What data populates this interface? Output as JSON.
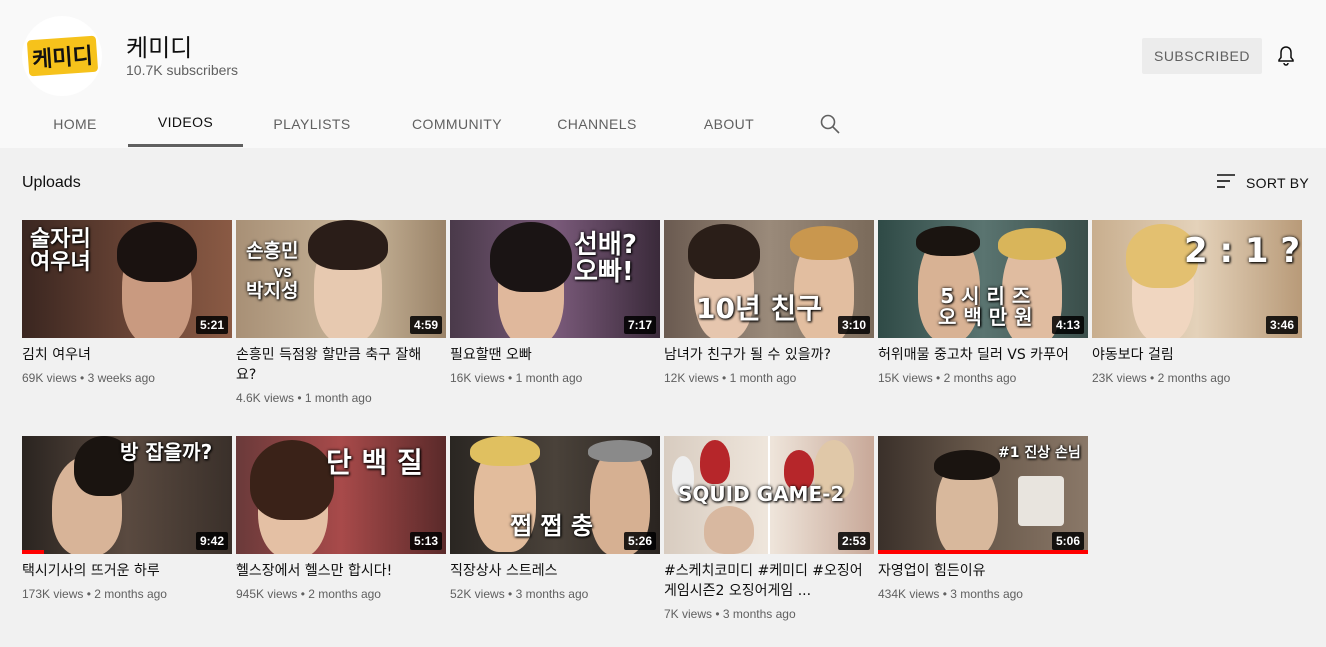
{
  "channel": {
    "name": "케미디",
    "subscribers": "10.7K subscribers",
    "avatar_text": "케미디",
    "subscribe_label": "SUBSCRIBED"
  },
  "tabs": [
    {
      "label": "HOME"
    },
    {
      "label": "VIDEOS"
    },
    {
      "label": "PLAYLISTS"
    },
    {
      "label": "COMMUNITY"
    },
    {
      "label": "CHANNELS"
    },
    {
      "label": "ABOUT"
    }
  ],
  "section": {
    "title": "Uploads",
    "sort_label": "SORT BY"
  },
  "videos": [
    {
      "title": "김치 여우녀",
      "views": "69K views",
      "age": "3 weeks ago",
      "duration": "5:21",
      "thumb_text": "술자리\n여우녀",
      "bg": "#5a3a2c"
    },
    {
      "title": "손흥민 득점왕 할만큼 축구 잘해요?",
      "views": "4.6K views",
      "age": "1 month ago",
      "duration": "4:59",
      "thumb_text": "손흥민\nVS\n박지성",
      "bg": "#b9a58c"
    },
    {
      "title": "필요할땐 오빠",
      "views": "16K views",
      "age": "1 month ago",
      "duration": "7:17",
      "thumb_text": "선배?\n오빠!",
      "bg": "#6b4a6a"
    },
    {
      "title": "남녀가 친구가 될 수 있을까?",
      "views": "12K views",
      "age": "1 month ago",
      "duration": "3:10",
      "thumb_text": "10년 친구",
      "bg": "#8a7a6a"
    },
    {
      "title": "허위매물 중고차 딜러 VS 카푸어",
      "views": "15K views",
      "age": "2 months ago",
      "duration": "4:13",
      "thumb_text": "5 시 리 즈\n오 백 만 원",
      "bg": "#3f5a55"
    },
    {
      "title": "야동보다 걸림",
      "views": "23K views",
      "age": "2 months ago",
      "duration": "3:46",
      "thumb_text": "2 : 1 ?",
      "bg": "#d9c3a6"
    },
    {
      "title": "택시기사의 뜨거운 하루",
      "views": "173K views",
      "age": "2 months ago",
      "duration": "9:42",
      "thumb_text": "방 잡을까?",
      "bg": "#4a4038"
    },
    {
      "title": "헬스장에서 헬스만 합시다!",
      "views": "945K views",
      "age": "2 months ago",
      "duration": "5:13",
      "thumb_text": "단 백 질",
      "bg": "#7a3a3a"
    },
    {
      "title": "직장상사 스트레스",
      "views": "52K views",
      "age": "3 months ago",
      "duration": "5:26",
      "thumb_text": "쩝 쩝 충",
      "bg": "#3a3430"
    },
    {
      "title": "#스케치코미디 #케미디 #오징어게임시즌2 오징어게임 ...",
      "views": "7K views",
      "age": "3 months ago",
      "duration": "2:53",
      "thumb_text": "SQUID GAME 2",
      "bg": "#c9b8a8"
    },
    {
      "title": "자영업이 힘든이유",
      "views": "434K views",
      "age": "3 months ago",
      "duration": "5:06",
      "thumb_text": "#1 진상 손님",
      "bg": "#5a4a3c"
    }
  ]
}
